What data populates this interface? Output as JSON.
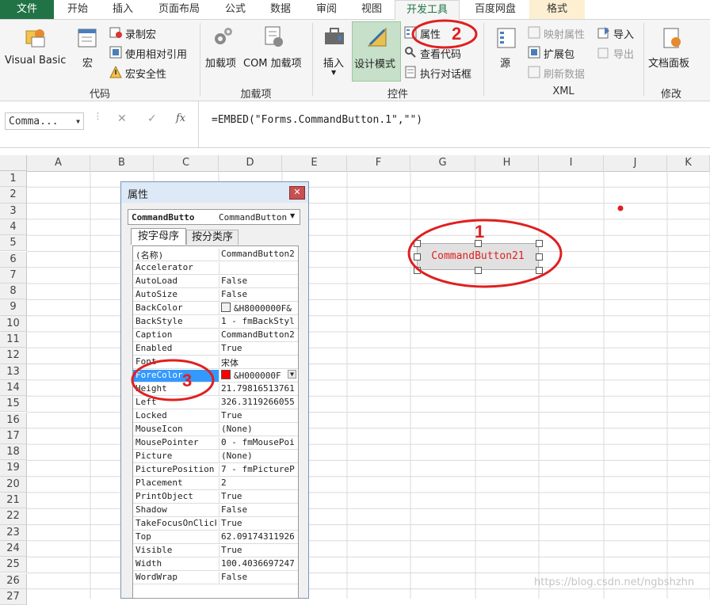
{
  "tabs": [
    "文件",
    "开始",
    "插入",
    "页面布局",
    "公式",
    "数据",
    "审阅",
    "视图",
    "开发工具",
    "百度网盘",
    "格式"
  ],
  "ribbon": {
    "code_group": {
      "label": "代码",
      "visual_basic": "Visual Basic",
      "macros": "宏",
      "record_macro": "录制宏",
      "relative_ref": "使用相对引用",
      "macro_security": "宏安全性"
    },
    "addins_group": {
      "label": "加载项",
      "addins": "加载项",
      "com_addins": "COM 加载项"
    },
    "controls_group": {
      "label": "控件",
      "insert": "插入",
      "design_mode": "设计模式",
      "properties": "属性",
      "view_code": "查看代码",
      "run_dialog": "执行对话框"
    },
    "xml_group": {
      "label": "XML",
      "source": "源",
      "map_props": "映射属性",
      "expansion": "扩展包",
      "refresh": "刷新数据",
      "import": "导入",
      "export": "导出"
    },
    "modify_group": {
      "label": "修改",
      "doc_panel": "文档面板"
    }
  },
  "formula_bar": {
    "name_box": "Comma...",
    "cancel": "✕",
    "enter": "✓",
    "fx": "fx",
    "formula": "=EMBED(\"Forms.CommandButton.1\",\"\")"
  },
  "columns": [
    "A",
    "B",
    "C",
    "D",
    "E",
    "F",
    "G",
    "H",
    "I",
    "J",
    "K"
  ],
  "rows": [
    "1",
    "2",
    "3",
    "4",
    "5",
    "6",
    "7",
    "8",
    "9",
    "10",
    "11",
    "12",
    "13",
    "14",
    "15",
    "16",
    "17",
    "18",
    "19",
    "20",
    "21",
    "22",
    "23",
    "24",
    "25",
    "26",
    "27"
  ],
  "properties_window": {
    "title": "属性",
    "object_name": "CommandButto",
    "object_type": "CommandButton",
    "tab_alpha": "按字母序",
    "tab_category": "按分类序",
    "rows": [
      {
        "name": "(名称)",
        "value": "CommandButton2"
      },
      {
        "name": "Accelerator",
        "value": ""
      },
      {
        "name": "AutoLoad",
        "value": "False"
      },
      {
        "name": "AutoSize",
        "value": "False"
      },
      {
        "name": "BackColor",
        "value": "&H8000000F&"
      },
      {
        "name": "BackStyle",
        "value": "1 - fmBackStyl"
      },
      {
        "name": "Caption",
        "value": "CommandButton2"
      },
      {
        "name": "Enabled",
        "value": "True"
      },
      {
        "name": "Font",
        "value": "宋体"
      },
      {
        "name": "ForeColor",
        "value": "&H000000F"
      },
      {
        "name": "Height",
        "value": "21.79816513761"
      },
      {
        "name": "Left",
        "value": "326.3119266055"
      },
      {
        "name": "Locked",
        "value": "True"
      },
      {
        "name": "MouseIcon",
        "value": "(None)"
      },
      {
        "name": "MousePointer",
        "value": "0 - fmMousePoi"
      },
      {
        "name": "Picture",
        "value": "(None)"
      },
      {
        "name": "PicturePosition",
        "value": "7 - fmPictureP"
      },
      {
        "name": "Placement",
        "value": "2"
      },
      {
        "name": "PrintObject",
        "value": "True"
      },
      {
        "name": "Shadow",
        "value": "False"
      },
      {
        "name": "TakeFocusOnClick",
        "value": "True"
      },
      {
        "name": "Top",
        "value": "62.09174311926"
      },
      {
        "name": "Visible",
        "value": "True"
      },
      {
        "name": "Width",
        "value": "100.4036697247"
      },
      {
        "name": "WordWrap",
        "value": "False"
      }
    ]
  },
  "command_button": {
    "caption": "CommandButton21"
  },
  "annotations": {
    "one": "1",
    "two": "2",
    "three": "3"
  },
  "watermark": "https://blog.csdn.net/ngbshzhn",
  "colors": {
    "excel_green": "#217346",
    "annotation_red": "#e01f1f",
    "forecolor_swatch": "#ff0000"
  }
}
